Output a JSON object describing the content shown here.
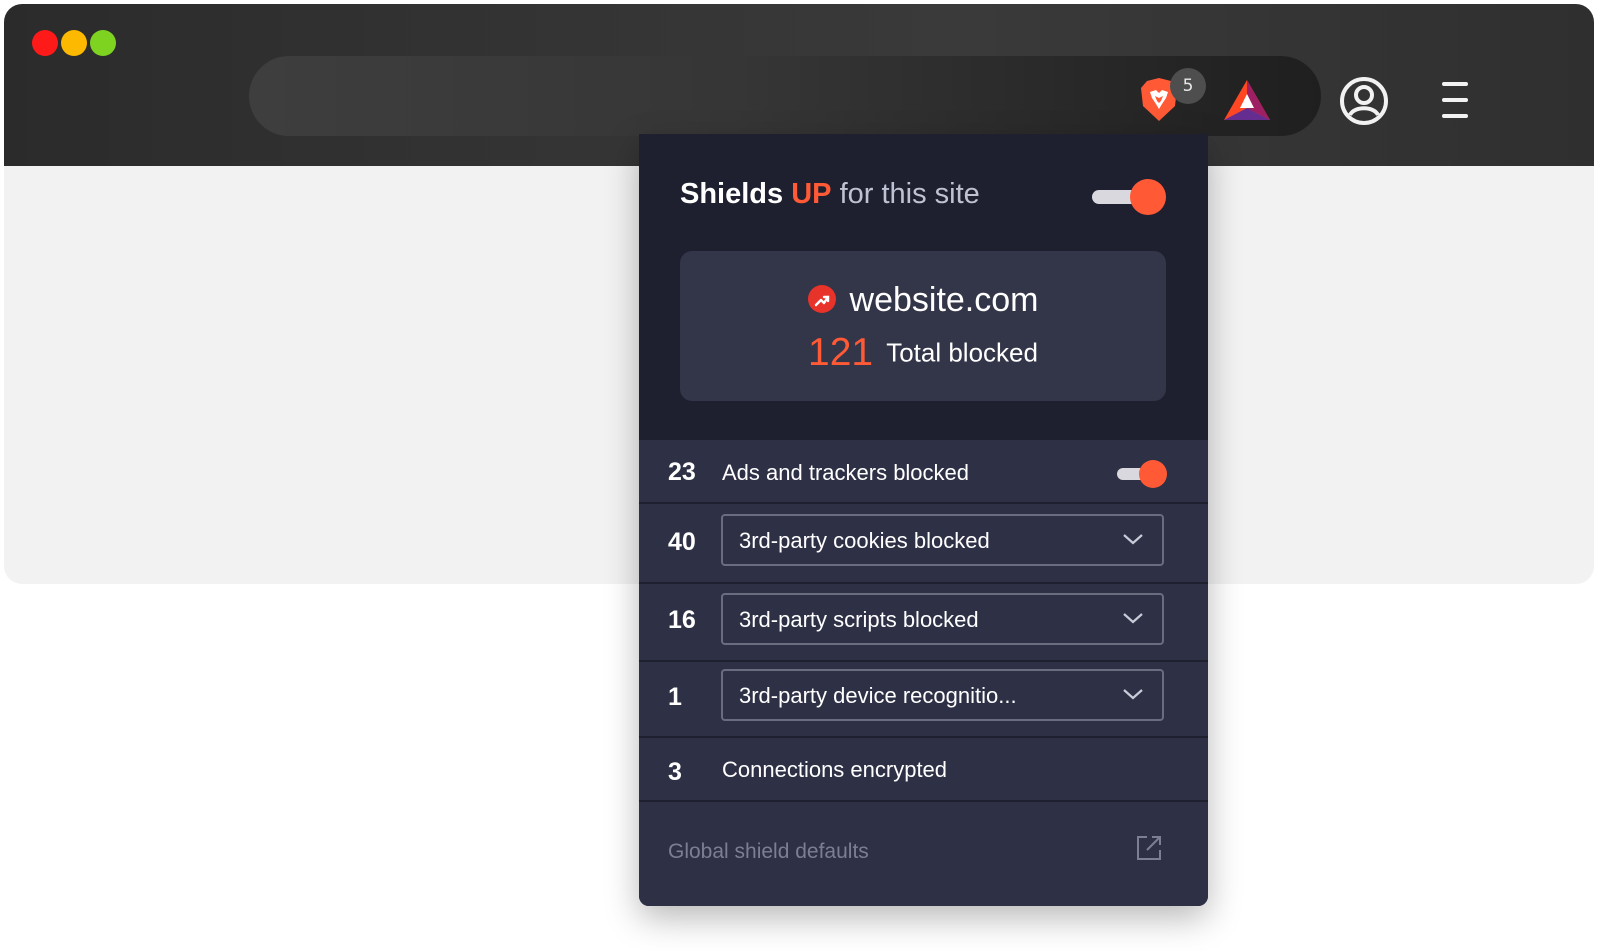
{
  "window": {
    "traffic_lights": [
      "close",
      "minimize",
      "maximize"
    ]
  },
  "toolbar": {
    "shields_badge_count": "5",
    "icons": [
      "brave-shields-icon",
      "bat-rewards-icon",
      "profile-icon",
      "menu-icon"
    ]
  },
  "panel": {
    "title_part1": "Shields",
    "title_up": "UP",
    "title_part2": "for this site",
    "shields_enabled": true,
    "site_name": "website.com",
    "total_blocked_count": "121",
    "total_blocked_label": "Total blocked",
    "rows": [
      {
        "count": "23",
        "label": "Ads and trackers blocked",
        "type": "toggle",
        "enabled": true
      },
      {
        "count": "40",
        "label": "3rd-party cookies blocked",
        "type": "select"
      },
      {
        "count": "16",
        "label": "3rd-party scripts blocked",
        "type": "select"
      },
      {
        "count": "1",
        "label": "3rd-party device recognitio...",
        "type": "select"
      },
      {
        "count": "3",
        "label": "Connections encrypted",
        "type": "static"
      }
    ],
    "footer_label": "Global shield defaults"
  },
  "colors": {
    "accent": "#ff5a35",
    "panel_bg": "#1e2030",
    "row_bg": "#2e3046",
    "card_bg": "#333548"
  }
}
